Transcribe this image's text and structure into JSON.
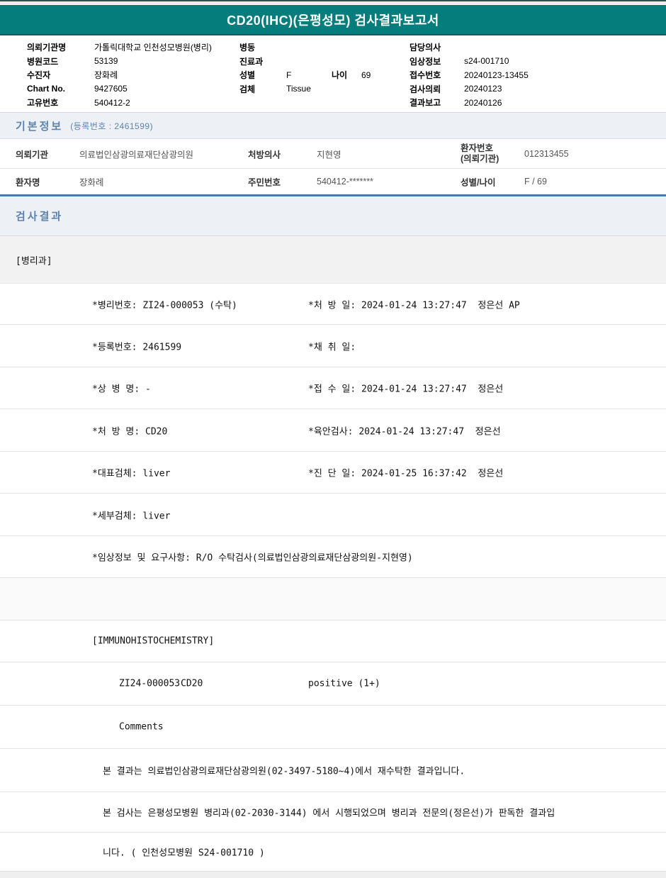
{
  "title_bar": {
    "title": "CD20(IHC)(은평성모) 검사결과보고서"
  },
  "patient_header": {
    "left": [
      {
        "label": "의뢰기관명",
        "value": "가톨릭대학교 인천성모병원(병리)"
      },
      {
        "label": "병원코드",
        "value": "53139"
      },
      {
        "label": "수진자",
        "value": "장화례"
      },
      {
        "label": "Chart No.",
        "value": "9427605"
      },
      {
        "label": "고유번호",
        "value": "540412-2"
      }
    ],
    "middle": [
      {
        "label": "병동",
        "value": ""
      },
      {
        "label": "진료과",
        "value": ""
      },
      {
        "label": "성별",
        "value": "F",
        "label2": "나이",
        "value2": "69"
      },
      {
        "label": "검체",
        "value": "Tissue"
      }
    ],
    "right": [
      {
        "label": "담당의사",
        "value": ""
      },
      {
        "label": "임상정보",
        "value": "s24-001710"
      },
      {
        "label": "접수번호",
        "value": "20240123-13455"
      },
      {
        "label": "검사의뢰",
        "value": "20240123"
      },
      {
        "label": "결과보고",
        "value": "20240126"
      }
    ]
  },
  "basic_info": {
    "title": "기본정보",
    "reg_note": "(등록번호 : 2461599)",
    "row1": {
      "label1": "의뢰기관",
      "value1": "의료법인삼광의료재단삼광의원",
      "label2": "처방의사",
      "value2": "지현영",
      "label3a": "환자번호",
      "label3b": "(의뢰기관)",
      "value3": "012313455"
    },
    "row2": {
      "label1": "환자명",
      "value1": "장화례",
      "label2": "주민번호",
      "value2": "540412-*******",
      "label3": "성별/나이",
      "value3": "F / 69"
    }
  },
  "results": {
    "title": "검사결과",
    "department": "[병리과]",
    "detail_rows": [
      {
        "left": "*병리번호: ZI24-000053 (수탁)",
        "right": "*처 방 일: 2024-01-24 13:27:47  정은선 AP"
      },
      {
        "left": "*등록번호: 2461599",
        "right": "*채 취 일:"
      },
      {
        "left": "*상 병 명: -",
        "right": "*접 수 일: 2024-01-24 13:27:47  정은선"
      },
      {
        "left": "*처 방 명: CD20",
        "right": "*육안검사: 2024-01-24 13:27:47  정은선"
      },
      {
        "left": "*대표검체: liver",
        "right": "*진 단 일: 2024-01-25 16:37:42  정은선"
      },
      {
        "left": "*세부검체: liver",
        "right": ""
      },
      {
        "left": "*임상정보 및 요구사항: R/O 수탁검사(의료법인삼광의료재단삼광의원-지현영)",
        "right": ""
      }
    ],
    "ihc": {
      "section_label": "[IMMUNOHISTOCHEMISTRY]",
      "pathology_no": "ZI24-000053",
      "test_name": "CD20",
      "result_value": "positive (1+)"
    },
    "comments": {
      "label": "Comments",
      "lines": [
        "본 결과는 의료법인삼광의료재단삼광의원(02-3497-5180~4)에서 재수탁한 결과입니다.",
        "본 검사는 은평성모병원 병리과(02-2030-3144) 에서 시행되었으며 병리과 전문의(정은선)가 판독한 결과입",
        "니다. ( 인천성모병원 S24-001710 )"
      ]
    }
  },
  "colors": {
    "header_teal": "#057d7d",
    "section_title_blue": "#5d83ad",
    "accent_rule_blue": "#4e79a7"
  }
}
